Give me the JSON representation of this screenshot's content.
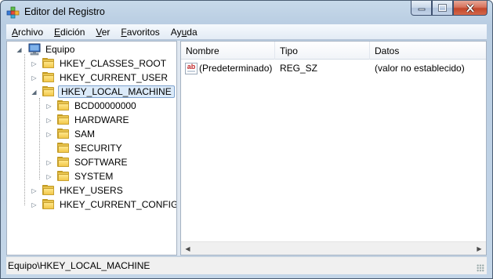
{
  "window": {
    "title": "Editor del Registro",
    "icon": "registry-editor-icon"
  },
  "menu": [
    {
      "label": "Archivo",
      "key": "A",
      "rest": "rchivo"
    },
    {
      "label": "Edición",
      "key": "E",
      "rest": "dición"
    },
    {
      "label": "Ver",
      "key": "V",
      "rest": "er"
    },
    {
      "label": "Favoritos",
      "key": "F",
      "rest": "avoritos"
    },
    {
      "label": "Ayuda",
      "prefix": "Ay",
      "key": "u",
      "rest": "da"
    }
  ],
  "tree": {
    "root": "Equipo",
    "hives": [
      {
        "label": "HKEY_CLASSES_ROOT",
        "expandable": true
      },
      {
        "label": "HKEY_CURRENT_USER",
        "expandable": true
      },
      {
        "label": "HKEY_LOCAL_MACHINE",
        "expanded": true,
        "selected": true,
        "children": [
          {
            "label": "BCD00000000",
            "expandable": true
          },
          {
            "label": "HARDWARE",
            "expandable": true
          },
          {
            "label": "SAM",
            "expandable": true
          },
          {
            "label": "SECURITY",
            "expandable": false
          },
          {
            "label": "SOFTWARE",
            "expandable": true
          },
          {
            "label": "SYSTEM",
            "expandable": true
          }
        ]
      },
      {
        "label": "HKEY_USERS",
        "expandable": true
      },
      {
        "label": "HKEY_CURRENT_CONFIG",
        "expandable": true
      }
    ]
  },
  "list": {
    "columns": [
      "Nombre",
      "Tipo",
      "Datos"
    ],
    "rows": [
      {
        "name": "(Predeterminado)",
        "type": "REG_SZ",
        "data": "(valor no establecido)",
        "icon": "string-value-icon"
      }
    ]
  },
  "status": {
    "path": "Equipo\\HKEY_LOCAL_MACHINE"
  }
}
